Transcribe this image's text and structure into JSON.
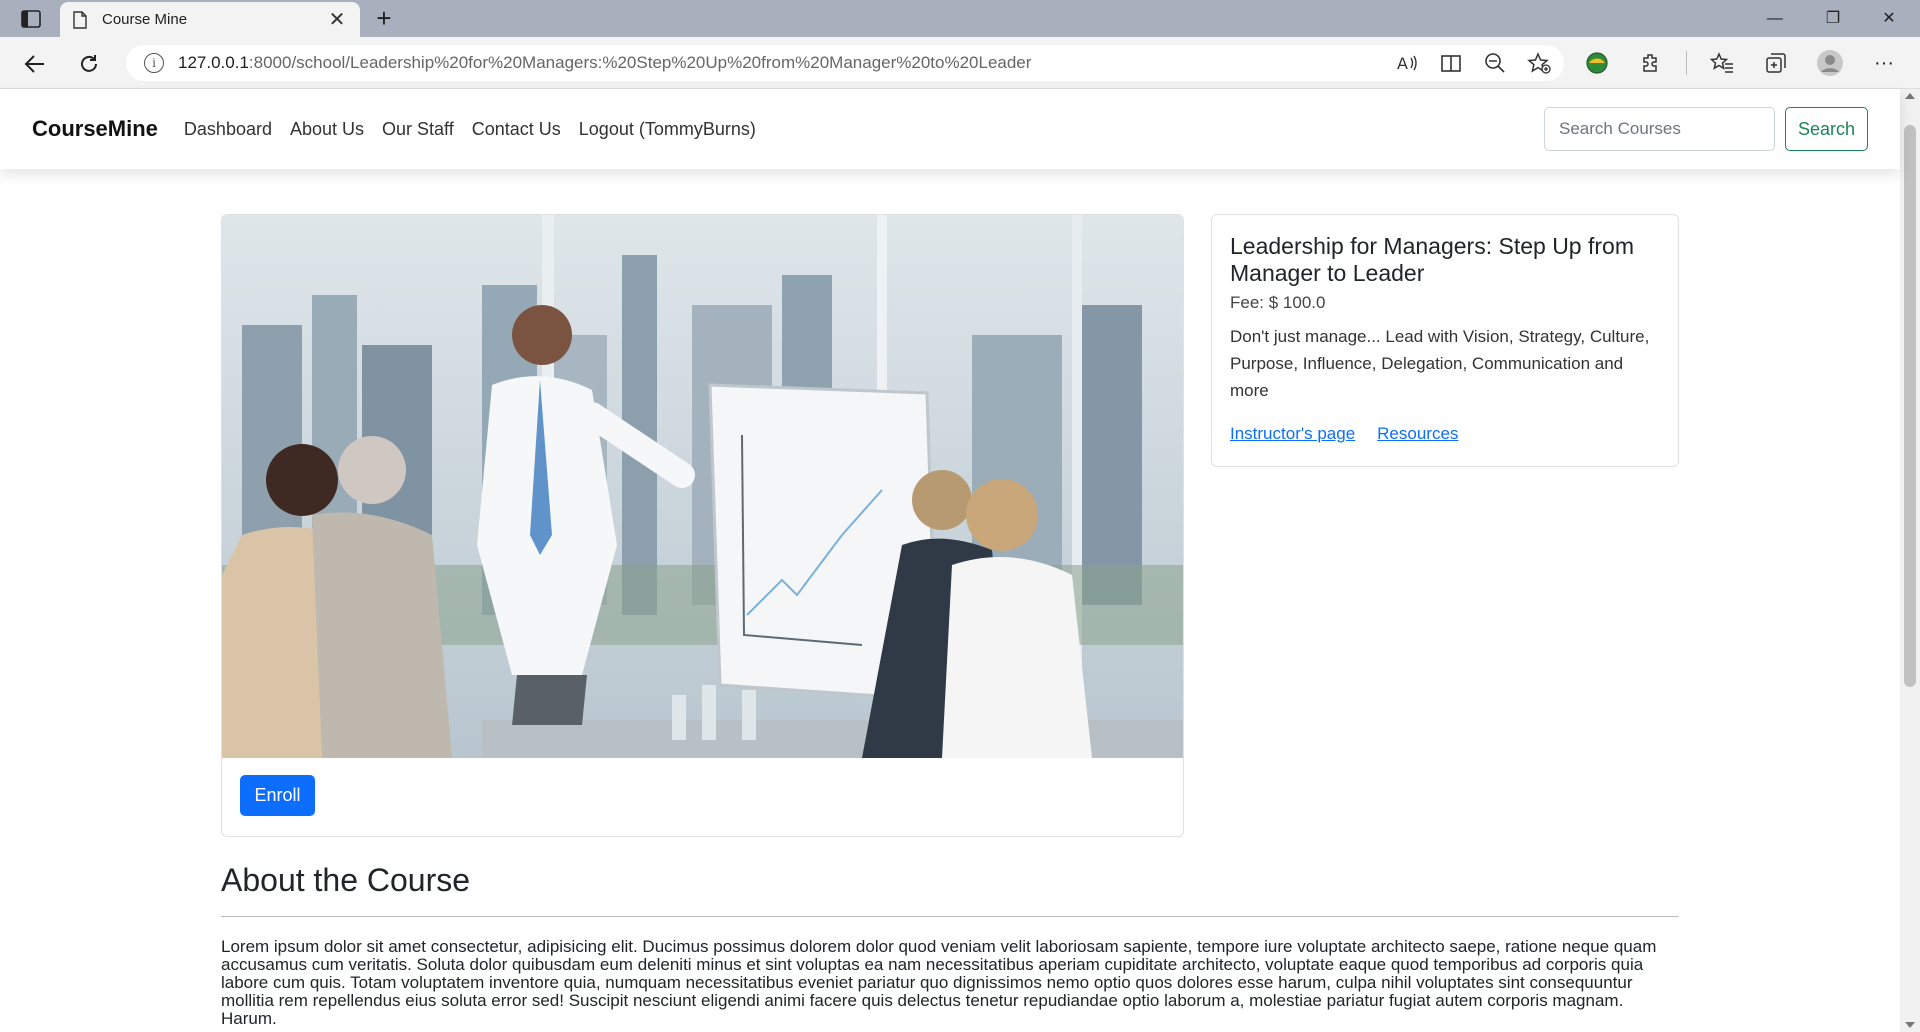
{
  "browser": {
    "tab_title": "Course Mine",
    "url_host": "127.0.0.1",
    "url_rest": ":8000/school/Leadership%20for%20Managers:%20Step%20Up%20from%20Manager%20to%20Leader"
  },
  "navbar": {
    "brand": "CourseMine",
    "links": [
      "Dashboard",
      "About Us",
      "Our Staff",
      "Contact Us",
      "Logout (TommyBurns)"
    ],
    "search_placeholder": "Search Courses",
    "search_label": "Search"
  },
  "course": {
    "image_description": "office-meeting-photo",
    "enroll_label": "Enroll",
    "title": "Leadership for Managers: Step Up from Manager to Leader",
    "fee": "Fee: $ 100.0",
    "description": "Don't just manage... Lead with Vision, Strategy, Culture, Purpose, Influence, Delegation, Communication and more",
    "instructor_link": "Instructor's page",
    "resources_link": "Resources"
  },
  "about": {
    "heading": "About the Course",
    "body": "Lorem ipsum dolor sit amet consectetur, adipisicing elit. Ducimus possimus dolorem dolor quod veniam velit laboriosam sapiente, tempore iure voluptate architecto saepe, ratione neque quam accusamus cum veritatis. Soluta dolor quibusdam eum deleniti minus et sint voluptas ea nam necessitatibus aperiam cupiditate architecto, voluptate eaque quod temporibus ad corporis quia labore cum quis. Totam voluptatem inventore quia, numquam necessitatibus eveniet pariatur quo dignissimos nemo optio quos dolores esse harum, culpa nihil voluptates sint consequuntur mollitia rem repellendus eius soluta error sed! Suscipit nesciunt eligendi animi facere quis delectus tenetur repudiandae optio laborum a, molestiae pariatur fugiat autem corporis magnam. Harum."
  },
  "colors": {
    "primary": "#0d6efd",
    "success": "#198754",
    "chrome_tabbar": "#a9b0bd"
  }
}
